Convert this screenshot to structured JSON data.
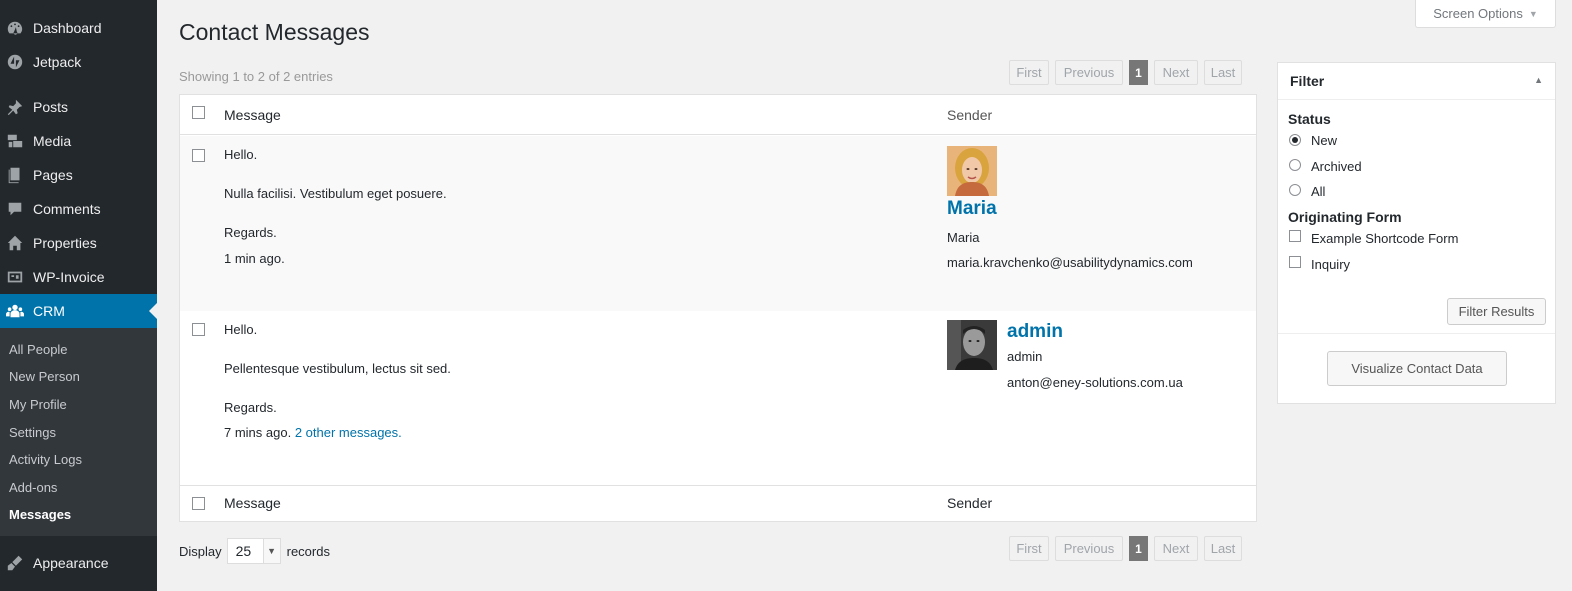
{
  "sidebar": {
    "items": [
      {
        "label": "Dashboard",
        "icon": "dashboard-icon"
      },
      {
        "label": "Jetpack",
        "icon": "jetpack-icon"
      },
      {
        "label": "Posts",
        "icon": "pin-icon"
      },
      {
        "label": "Media",
        "icon": "media-icon"
      },
      {
        "label": "Pages",
        "icon": "pages-icon"
      },
      {
        "label": "Comments",
        "icon": "comments-icon"
      },
      {
        "label": "Properties",
        "icon": "home-icon"
      },
      {
        "label": "WP-Invoice",
        "icon": "invoice-icon"
      },
      {
        "label": "CRM",
        "icon": "groups-icon"
      },
      {
        "label": "Appearance",
        "icon": "brush-icon"
      }
    ],
    "submenu": [
      "All People",
      "New Person",
      "My Profile",
      "Settings",
      "Activity Logs",
      "Add-ons",
      "Messages"
    ]
  },
  "screen_options": "Screen Options",
  "page_title": "Contact Messages",
  "showing": "Showing 1 to 2 of 2 entries",
  "pagination": {
    "first": "First",
    "previous": "Previous",
    "page": "1",
    "next": "Next",
    "last": "Last"
  },
  "table": {
    "col_message": "Message",
    "col_sender": "Sender",
    "rows": [
      {
        "greeting": "Hello.",
        "body": "Nulla facilisi. Vestibulum eget posuere.",
        "regards": "Regards.",
        "time": "1 min ago.",
        "extra": "",
        "sender_name": "Maria",
        "sender_username": "Maria",
        "sender_email": "maria.kravchenko@usabilitydynamics.com"
      },
      {
        "greeting": "Hello.",
        "body": "Pellentesque vestibulum, lectus sit sed.",
        "regards": "Regards.",
        "time": "7 mins ago.",
        "extra": "2 other messages.",
        "sender_name": "admin",
        "sender_username": "admin",
        "sender_email": "anton@eney-solutions.com.ua"
      }
    ]
  },
  "display": {
    "label": "Display",
    "value": "25",
    "suffix": "records"
  },
  "filter": {
    "title": "Filter",
    "status_label": "Status",
    "status_options": [
      "New",
      "Archived",
      "All"
    ],
    "status_selected": "New",
    "form_label": "Originating Form",
    "form_options": [
      "Example Shortcode Form",
      "Inquiry"
    ],
    "filter_button": "Filter Results",
    "visualize_button": "Visualize Contact Data"
  },
  "colors": {
    "accent": "#0073aa",
    "sidebar": "#23282d",
    "submenu": "#32373c"
  }
}
